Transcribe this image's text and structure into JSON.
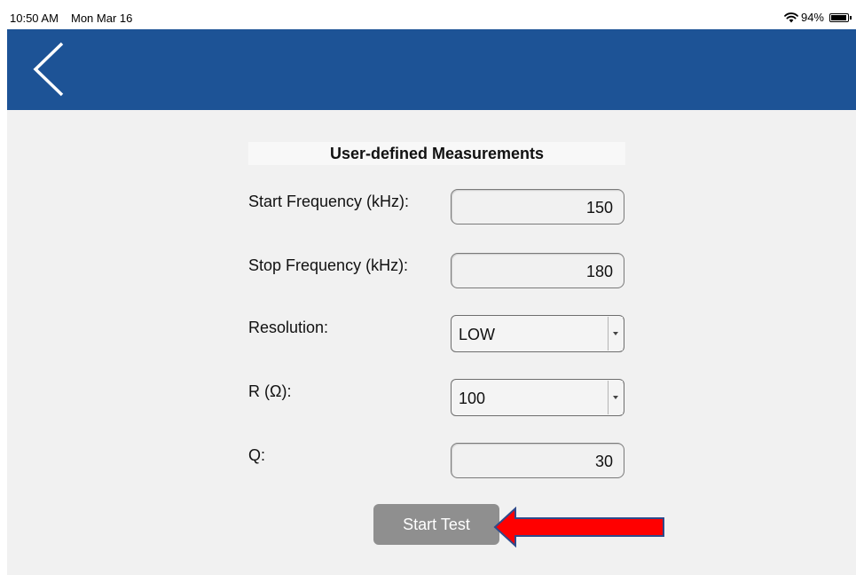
{
  "status_bar": {
    "time": "10:50 AM",
    "date": "Mon Mar 16",
    "battery_percent": "94%",
    "battery_level": 0.94
  },
  "nav": {
    "back_icon": "chevron-left-icon"
  },
  "form": {
    "title": "User-defined Measurements",
    "start_frequency": {
      "label": "Start Frequency (kHz):",
      "value": "150"
    },
    "stop_frequency": {
      "label": "Stop Frequency (kHz):",
      "value": "180"
    },
    "resolution": {
      "label": "Resolution:",
      "value": "LOW"
    },
    "r": {
      "label": "R (Ω):",
      "value": "100"
    },
    "q": {
      "label": "Q:",
      "value": "30"
    }
  },
  "start_button_label": "Start Test",
  "colors": {
    "nav_background": "#1d5396",
    "content_background": "#f1f1f1",
    "button_disabled": "#8f8f8f",
    "annotation_arrow": "#ff0000",
    "annotation_arrow_border": "#2f4a8a"
  },
  "annotation": {
    "icon": "red-arrow-left-icon"
  }
}
